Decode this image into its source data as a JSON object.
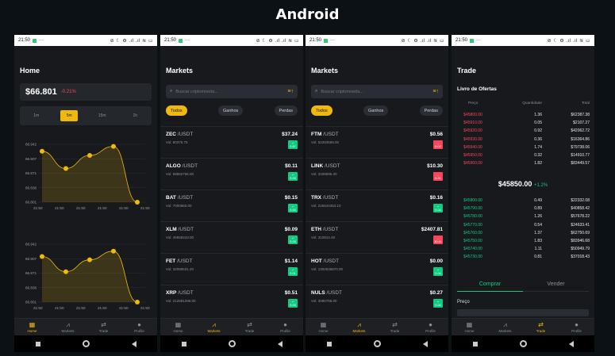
{
  "page_title": "Android",
  "status": {
    "time": "21:50",
    "dots": "···",
    "icons": "⊘ ☾ ⚙ .ıl .ıl ≋ ▭"
  },
  "nav": [
    {
      "label": "Home",
      "icon": "home-grid-icon"
    },
    {
      "label": "Markets",
      "icon": "chart-icon"
    },
    {
      "label": "Trade",
      "icon": "swap-icon"
    },
    {
      "label": "Profile",
      "icon": "person-icon"
    }
  ],
  "home": {
    "title": "Home",
    "price": "$66.801",
    "change": "-0.21%",
    "timeframes": [
      "1m",
      "5m",
      "15m",
      "1h"
    ],
    "active_timeframe": 1,
    "chart1": {
      "y_ticks": [
        "66.942",
        "66.907",
        "66.871",
        "66.836",
        "66.801"
      ],
      "x_ticks": [
        "21:50",
        "21:50",
        "21:50",
        "21:50",
        "21:50",
        "21:50"
      ]
    },
    "chart2": {
      "y_ticks": [
        "66.942",
        "66.907",
        "66.871",
        "66.836",
        "66.801"
      ],
      "x_ticks": [
        "21:50",
        "21:50",
        "21:50",
        "21:50",
        "21:50",
        "21:50"
      ]
    }
  },
  "chart_data": [
    {
      "type": "area",
      "x": [
        "21:50",
        "21:50",
        "21:50",
        "21:50",
        "21:50"
      ],
      "values": [
        66.925,
        66.883,
        66.915,
        66.937,
        66.801
      ],
      "ylim": [
        66.801,
        66.942
      ],
      "title": "",
      "xlabel": "",
      "ylabel": ""
    },
    {
      "type": "area",
      "x": [
        "21:50",
        "21:50",
        "21:50",
        "21:50",
        "21:50"
      ],
      "values": [
        66.912,
        66.875,
        66.904,
        66.925,
        66.801
      ],
      "ylim": [
        66.801,
        66.942
      ],
      "title": "",
      "xlabel": "",
      "ylabel": ""
    }
  ],
  "markets": {
    "title": "Markets",
    "search_placeholder": "Buscar criptomoeda...",
    "filters": [
      "Todos",
      "Ganhos",
      "Perdas"
    ],
    "list_a": [
      {
        "base": "ZEC",
        "quote": " /USDT",
        "vol": "Vol: 80376.75",
        "price": "$37.24",
        "pct_sign": "+",
        "pct": "0.87",
        "dir": "up"
      },
      {
        "base": "ALGO",
        "quote": " /USDT",
        "vol": "Vol: 58882766.00",
        "price": "$0.11",
        "pct_sign": "+",
        "pct": "0.00",
        "dir": "up"
      },
      {
        "base": "BAT",
        "quote": " /USDT",
        "vol": "Vol: 7000960.00",
        "price": "$0.15",
        "pct_sign": "+",
        "pct": "0.00",
        "dir": "up"
      },
      {
        "base": "XLM",
        "quote": " /USDT",
        "vol": "Vol: 46658243.00",
        "price": "$0.09",
        "pct_sign": "+",
        "pct": "0.00",
        "dir": "up"
      },
      {
        "base": "FET",
        "quote": " /USDT",
        "vol": "Vol: 32089531.40",
        "price": "$1.14",
        "pct_sign": "+",
        "pct": "0.01",
        "dir": "up"
      },
      {
        "base": "XRP",
        "quote": " /USDT",
        "vol": "Vol: 212581296.00",
        "price": "$0.51",
        "pct_sign": "+",
        "pct": "0.00",
        "dir": "up"
      }
    ],
    "list_b": [
      {
        "base": "FTM",
        "quote": " /USDT",
        "vol": "Vol: 52283569.00",
        "price": "$0.56",
        "pct_sign": "-",
        "pct": "0.02",
        "dir": "down"
      },
      {
        "base": "LINK",
        "quote": " /USDT",
        "vol": "Vol: 3339596.30",
        "price": "$10.30",
        "pct_sign": "-",
        "pct": "0.31",
        "dir": "down"
      },
      {
        "base": "TRX",
        "quote": " /USDT",
        "vol": "Vol: 226644353.10",
        "price": "$0.16",
        "pct_sign": "+",
        "pct": "0.00",
        "dir": "up"
      },
      {
        "base": "ETH",
        "quote": " /USDT",
        "vol": "Vol: 312814.49",
        "price": "$2407.81",
        "pct_sign": "-",
        "pct": "30.41",
        "dir": "down"
      },
      {
        "base": "HOT",
        "quote": " /USDT",
        "vol": "Vol: 1302636870.00",
        "price": "$0.00",
        "pct_sign": "+",
        "pct": "0.00",
        "dir": "up"
      },
      {
        "base": "NULS",
        "quote": " /USDT",
        "vol": "Vol: 3086786.00",
        "price": "$0.27",
        "pct_sign": "+",
        "pct": "0.00",
        "dir": "up"
      }
    ]
  },
  "trade": {
    "title": "Trade",
    "orderbook_title": "Livro de Ofertas",
    "headers": [
      "Preço",
      "Quantidade",
      "Total"
    ],
    "asks": [
      [
        "$45800.00",
        "1.36",
        "$62387.38"
      ],
      [
        "$45910.00",
        "0.05",
        "$2107.27"
      ],
      [
        "$45920.00",
        "0.92",
        "$42062.72"
      ],
      [
        "$45930.00",
        "0.36",
        "$16364.86"
      ],
      [
        "$45940.00",
        "1.74",
        "$79738.06"
      ],
      [
        "$45950.00",
        "0.32",
        "$14910.77"
      ],
      [
        "$45960.00",
        "1.82",
        "$83449.57"
      ]
    ],
    "mid_price": "$45850.00",
    "mid_change": "+1.2%",
    "bids": [
      [
        "$45800.00",
        "0.49",
        "$22332.08"
      ],
      [
        "$45790.00",
        "0.89",
        "$40858.42"
      ],
      [
        "$45780.00",
        "1.26",
        "$57678.22"
      ],
      [
        "$45770.00",
        "0.54",
        "$24633.41"
      ],
      [
        "$45760.00",
        "1.37",
        "$62750.69"
      ],
      [
        "$45750.00",
        "1.83",
        "$83946.68"
      ],
      [
        "$45740.00",
        "1.11",
        "$50949.79"
      ],
      [
        "$45730.00",
        "0.81",
        "$37018.43"
      ]
    ],
    "tabs": [
      "Comprar",
      "Vender"
    ],
    "price_label": "Preço"
  },
  "colors": {
    "accent": "#f0b90b",
    "up": "#0ecb81",
    "down": "#f6465d",
    "bg": "#17191d"
  }
}
